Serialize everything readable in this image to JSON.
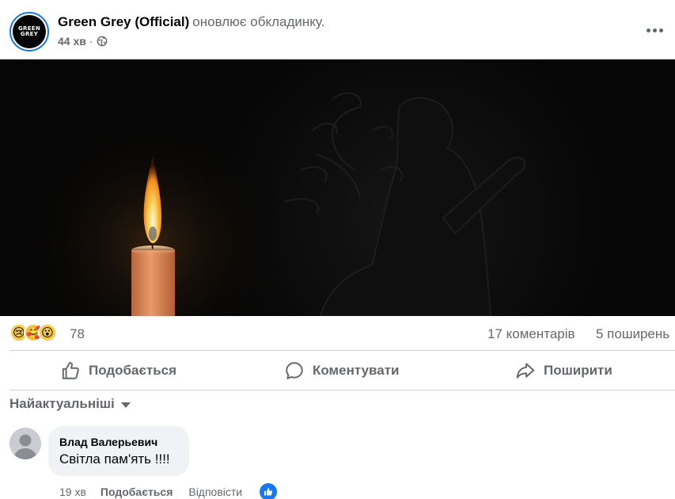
{
  "post": {
    "page_name": "Green Grey (Official)",
    "action": "оновлює обкладинку.",
    "time": "44 хв",
    "separator": "·",
    "avatar_text_line1": "GREEN",
    "avatar_text_line2": "GREY"
  },
  "reactions": {
    "count": "78",
    "types": [
      "sad-icon",
      "care-icon",
      "wow-icon"
    ],
    "comments": "17 коментарів",
    "shares": "5 поширень"
  },
  "actions": {
    "like": "Подобається",
    "comment": "Коментувати",
    "share": "Поширити"
  },
  "comments_section": {
    "sort_label": "Найактуальніші",
    "items": [
      {
        "author": "Влад Валерьевич",
        "text": "Світла пам'ять !!!!",
        "time": "19 хв",
        "like": "Подобається",
        "reply": "Відповісти",
        "reaction": "like-icon"
      }
    ]
  },
  "colors": {
    "accent": "#1877f2",
    "secondary_text": "#65676b",
    "bubble": "#f0f2f5",
    "divider": "#ced0d4"
  }
}
